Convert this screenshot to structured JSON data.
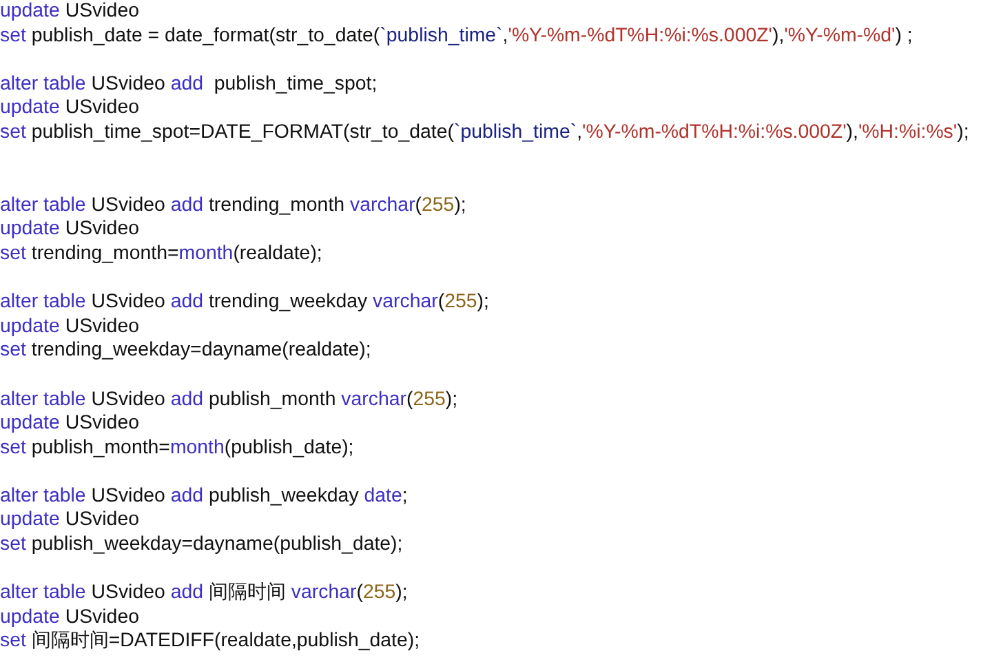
{
  "editor": {
    "lines": [
      {
        "kind": "code",
        "tokens": [
          {
            "kind": "keyword",
            "text": "update"
          },
          {
            "kind": "plain",
            "text": " USvideo"
          }
        ]
      },
      {
        "kind": "code",
        "tokens": [
          {
            "kind": "keyword",
            "text": "set"
          },
          {
            "kind": "plain",
            "text": " publish_date = date_format(str_to_date("
          },
          {
            "kind": "ident",
            "text": "`publish_time`"
          },
          {
            "kind": "plain",
            "text": ","
          },
          {
            "kind": "string",
            "text": "'%Y-%m-%dT%H:%i:%s.000Z'"
          },
          {
            "kind": "plain",
            "text": "),"
          },
          {
            "kind": "string",
            "text": "'%Y-%m-%d'"
          },
          {
            "kind": "plain",
            "text": ") ;"
          }
        ]
      },
      {
        "kind": "blank"
      },
      {
        "kind": "code",
        "tokens": [
          {
            "kind": "keyword",
            "text": "alter table"
          },
          {
            "kind": "plain",
            "text": " USvideo "
          },
          {
            "kind": "keyword",
            "text": "add"
          },
          {
            "kind": "plain",
            "text": "  publish_time_spot;"
          }
        ]
      },
      {
        "kind": "code",
        "tokens": [
          {
            "kind": "keyword",
            "text": "update"
          },
          {
            "kind": "plain",
            "text": " USvideo"
          }
        ]
      },
      {
        "kind": "code",
        "tokens": [
          {
            "kind": "keyword",
            "text": "set"
          },
          {
            "kind": "plain",
            "text": " publish_time_spot=DATE_FORMAT(str_to_date("
          },
          {
            "kind": "ident",
            "text": "`publish_time`"
          },
          {
            "kind": "plain",
            "text": ","
          },
          {
            "kind": "string",
            "text": "'%Y-%m-%dT%H:%i:%s.000Z'"
          },
          {
            "kind": "plain",
            "text": "),"
          },
          {
            "kind": "string",
            "text": "'%H:%i:%s'"
          },
          {
            "kind": "plain",
            "text": ");"
          }
        ]
      },
      {
        "kind": "blank"
      },
      {
        "kind": "blank"
      },
      {
        "kind": "code",
        "tokens": [
          {
            "kind": "keyword",
            "text": "alter table"
          },
          {
            "kind": "plain",
            "text": " USvideo "
          },
          {
            "kind": "keyword",
            "text": "add"
          },
          {
            "kind": "plain",
            "text": " trending_month "
          },
          {
            "kind": "keyword",
            "text": "varchar"
          },
          {
            "kind": "plain",
            "text": "("
          },
          {
            "kind": "number",
            "text": "255"
          },
          {
            "kind": "plain",
            "text": ");"
          }
        ]
      },
      {
        "kind": "code",
        "tokens": [
          {
            "kind": "keyword",
            "text": "update"
          },
          {
            "kind": "plain",
            "text": " USvideo"
          }
        ]
      },
      {
        "kind": "code",
        "tokens": [
          {
            "kind": "keyword",
            "text": "set"
          },
          {
            "kind": "plain",
            "text": " trending_month="
          },
          {
            "kind": "keyword",
            "text": "month"
          },
          {
            "kind": "plain",
            "text": "(realdate);"
          }
        ]
      },
      {
        "kind": "blank"
      },
      {
        "kind": "code",
        "tokens": [
          {
            "kind": "keyword",
            "text": "alter table"
          },
          {
            "kind": "plain",
            "text": " USvideo "
          },
          {
            "kind": "keyword",
            "text": "add"
          },
          {
            "kind": "plain",
            "text": " trending_weekday "
          },
          {
            "kind": "keyword",
            "text": "varchar"
          },
          {
            "kind": "plain",
            "text": "("
          },
          {
            "kind": "number",
            "text": "255"
          },
          {
            "kind": "plain",
            "text": ");"
          }
        ]
      },
      {
        "kind": "code",
        "tokens": [
          {
            "kind": "keyword",
            "text": "update"
          },
          {
            "kind": "plain",
            "text": " USvideo"
          }
        ]
      },
      {
        "kind": "code",
        "tokens": [
          {
            "kind": "keyword",
            "text": "set"
          },
          {
            "kind": "plain",
            "text": " trending_weekday=dayname(realdate);"
          }
        ]
      },
      {
        "kind": "blank"
      },
      {
        "kind": "code",
        "tokens": [
          {
            "kind": "keyword",
            "text": "alter table"
          },
          {
            "kind": "plain",
            "text": " USvideo "
          },
          {
            "kind": "keyword",
            "text": "add"
          },
          {
            "kind": "plain",
            "text": " publish_month "
          },
          {
            "kind": "keyword",
            "text": "varchar"
          },
          {
            "kind": "plain",
            "text": "("
          },
          {
            "kind": "number",
            "text": "255"
          },
          {
            "kind": "plain",
            "text": ");"
          }
        ]
      },
      {
        "kind": "code",
        "tokens": [
          {
            "kind": "keyword",
            "text": "update"
          },
          {
            "kind": "plain",
            "text": " USvideo"
          }
        ]
      },
      {
        "kind": "code",
        "tokens": [
          {
            "kind": "keyword",
            "text": "set"
          },
          {
            "kind": "plain",
            "text": " publish_month="
          },
          {
            "kind": "keyword",
            "text": "month"
          },
          {
            "kind": "plain",
            "text": "(publish_date);"
          }
        ]
      },
      {
        "kind": "blank"
      },
      {
        "kind": "code",
        "tokens": [
          {
            "kind": "keyword",
            "text": "alter table"
          },
          {
            "kind": "plain",
            "text": " USvideo "
          },
          {
            "kind": "keyword",
            "text": "add"
          },
          {
            "kind": "plain",
            "text": " publish_weekday "
          },
          {
            "kind": "keyword",
            "text": "date"
          },
          {
            "kind": "plain",
            "text": ";"
          }
        ]
      },
      {
        "kind": "code",
        "tokens": [
          {
            "kind": "keyword",
            "text": "update"
          },
          {
            "kind": "plain",
            "text": " USvideo"
          }
        ]
      },
      {
        "kind": "code",
        "tokens": [
          {
            "kind": "keyword",
            "text": "set"
          },
          {
            "kind": "plain",
            "text": " publish_weekday=dayname(publish_date);"
          }
        ]
      },
      {
        "kind": "blank"
      },
      {
        "kind": "code",
        "tokens": [
          {
            "kind": "keyword",
            "text": "alter table"
          },
          {
            "kind": "plain",
            "text": " USvideo "
          },
          {
            "kind": "keyword",
            "text": "add"
          },
          {
            "kind": "plain",
            "text": " 间隔时间 "
          },
          {
            "kind": "keyword",
            "text": "varchar"
          },
          {
            "kind": "plain",
            "text": "("
          },
          {
            "kind": "number",
            "text": "255"
          },
          {
            "kind": "plain",
            "text": ");"
          }
        ]
      },
      {
        "kind": "code",
        "tokens": [
          {
            "kind": "keyword",
            "text": "update"
          },
          {
            "kind": "plain",
            "text": " USvideo"
          }
        ]
      },
      {
        "kind": "code",
        "tokens": [
          {
            "kind": "keyword",
            "text": "set"
          },
          {
            "kind": "plain",
            "text": " 间隔时间=DATEDIFF(realdate,publish_date);"
          }
        ]
      }
    ]
  }
}
